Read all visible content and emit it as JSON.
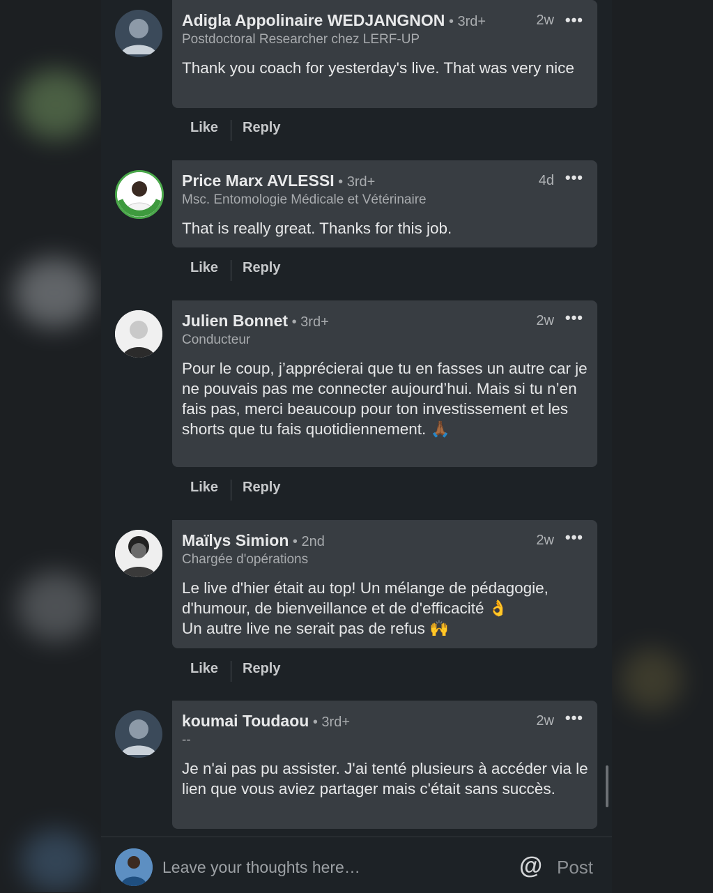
{
  "comments": [
    {
      "name": "Adigla Appolinaire WEDJANGNON",
      "degree": " • 3rd+",
      "time": "2w",
      "headline": "Postdoctoral Researcher chez LERF-UP",
      "text": "Thank you coach for yesterday's live. That was very nice",
      "avatar": "generic-avatar"
    },
    {
      "name": "Price Marx AVLESSI",
      "degree": " • 3rd+",
      "time": "4d",
      "headline": "Msc. Entomologie Médicale et Vétérinaire",
      "text": "That is really great. Thanks for this job.",
      "avatar": "photo-avatar",
      "open_to_work": "OPENTOWORK"
    },
    {
      "name": "Julien Bonnet",
      "degree": " • 3rd+",
      "time": "2w",
      "headline": "Conducteur",
      "text": "Pour le coup, j’apprécierai que tu en fasses un autre car je ne pouvais pas me connecter aujourd’hui. Mais si tu n’en fais pas, merci beaucoup pour ton investissement et les shorts que tu fais quotidiennement. 🙏🏾",
      "avatar": "photo-avatar"
    },
    {
      "name": "Maïlys Simion",
      "degree": " • 2nd",
      "time": "2w",
      "headline": "Chargée d'opérations",
      "text": "Le live d'hier était au top! Un mélange de pédagogie, d'humour, de bienveillance et de d'efficacité 👌\nUn autre live ne serait pas de refus 🙌",
      "avatar": "photo-avatar"
    },
    {
      "name": "koumai Toudaou",
      "degree": " • 3rd+",
      "time": "2w",
      "headline": "--",
      "text": "Je n'ai pas pu assister. J'ai tenté plusieurs à accéder via le lien que vous aviez partager mais c'était sans succès.",
      "avatar": "generic-avatar"
    }
  ],
  "actions": {
    "like": "Like",
    "reply": "Reply",
    "more": "•••"
  },
  "composer": {
    "placeholder": "Leave your thoughts here…",
    "mention_icon": "@",
    "post_label": "Post"
  },
  "colors": {
    "background": "#1d2226",
    "bubble": "#383d42",
    "text": "#e6e7e8",
    "muted": "#a8abae"
  }
}
